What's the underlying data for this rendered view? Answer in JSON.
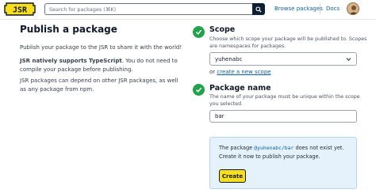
{
  "header": {
    "logo_text": "JSR",
    "search_placeholder": "Search for packages (⌘K)",
    "browse_label": "Browse packages",
    "docs_label": "Docs",
    "avatar_alt": "user avatar"
  },
  "left": {
    "title": "Publish a package",
    "p1": "Publish your package to the JSR to share it with the world!",
    "p2_bold": "JSR natively supports TypeScript",
    "p2_rest": ". You do not need to compile your package before publishing.",
    "p3": "JSR packages can depend on other JSR packages, as well as any package from npm."
  },
  "scope": {
    "title": "Scope",
    "description": "Choose which scope your package will be published to. Scopes are namespaces for packages.",
    "selected": "yuhenabc",
    "or_text": "or",
    "create_link": "create a new scope"
  },
  "package_name": {
    "title": "Package name",
    "description": "The name of your package must be unique within the scope you selected.",
    "value": "bar"
  },
  "notice": {
    "prefix": "The package",
    "package": "@yuhenabc/bar",
    "suffix": "does not exist yet. Create it now to publish your package.",
    "button": "Create"
  },
  "colors": {
    "accent": "#f7df1e",
    "step_green": "#22a24a",
    "link": "#0b62a8",
    "notice_bg": "#e6f2fb"
  }
}
